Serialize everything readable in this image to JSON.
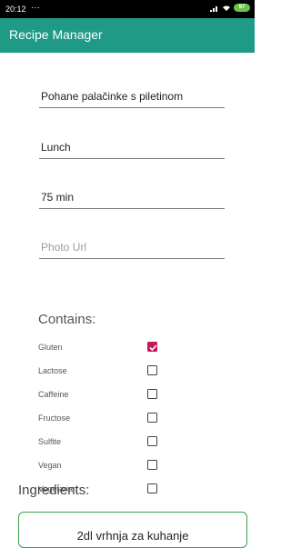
{
  "status_bar": {
    "time": "20:12",
    "dots": "···",
    "battery": "97"
  },
  "app_bar": {
    "title": "Recipe Manager"
  },
  "form": {
    "name": "Pohane palačinke s piletinom",
    "meal_type": "Lunch",
    "time": "75 min",
    "photo_url_placeholder": "Photo Url"
  },
  "contains": {
    "label": "Contains:",
    "items": [
      {
        "label": "Gluten",
        "checked": true
      },
      {
        "label": "Lactose",
        "checked": false
      },
      {
        "label": "Caffeine",
        "checked": false
      },
      {
        "label": "Fructose",
        "checked": false
      },
      {
        "label": "Sulfite",
        "checked": false
      },
      {
        "label": "Vegan",
        "checked": false
      },
      {
        "label": "Vegetarian",
        "checked": false
      }
    ]
  },
  "ingredients": {
    "label": "Ingredients:",
    "items": [
      "2dl vrhnja za kuhanje"
    ]
  },
  "colors": {
    "app_bar": "#1f9a86",
    "checkbox_checked": "#c2185b",
    "card_border": "#3aa04a"
  }
}
